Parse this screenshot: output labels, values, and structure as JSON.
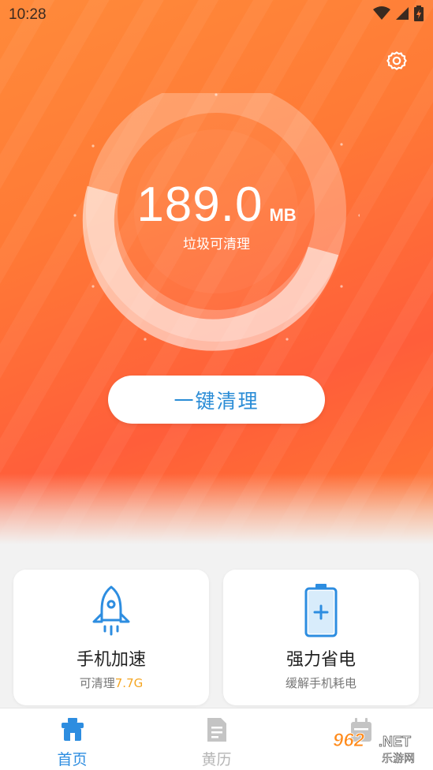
{
  "status_bar": {
    "time": "10:28"
  },
  "colors": {
    "hero_start": "#ff8a3a",
    "hero_end": "#ff5e3a",
    "accent_blue": "#2d8de0",
    "highlight_orange": "#f5a623"
  },
  "gauge": {
    "value": "189.0",
    "unit": "MB",
    "caption": "垃圾可清理"
  },
  "primary_action": {
    "label": "一键清理"
  },
  "cards": [
    {
      "icon": "rocket-icon",
      "title": "手机加速",
      "sub_prefix": "可清理",
      "sub_highlight": "7.7G"
    },
    {
      "icon": "battery-icon",
      "title": "强力省电",
      "sub_prefix": "缓解手机耗电",
      "sub_highlight": ""
    }
  ],
  "bottom_nav": [
    {
      "icon": "home-icon",
      "label": "首页",
      "active": true
    },
    {
      "icon": "calendar-note-icon",
      "label": "黄历",
      "active": false
    },
    {
      "icon": "calendar-icon",
      "label": "",
      "active": false
    }
  ],
  "watermark": {
    "text_top": "962.NET",
    "text_bottom": "乐游网"
  }
}
